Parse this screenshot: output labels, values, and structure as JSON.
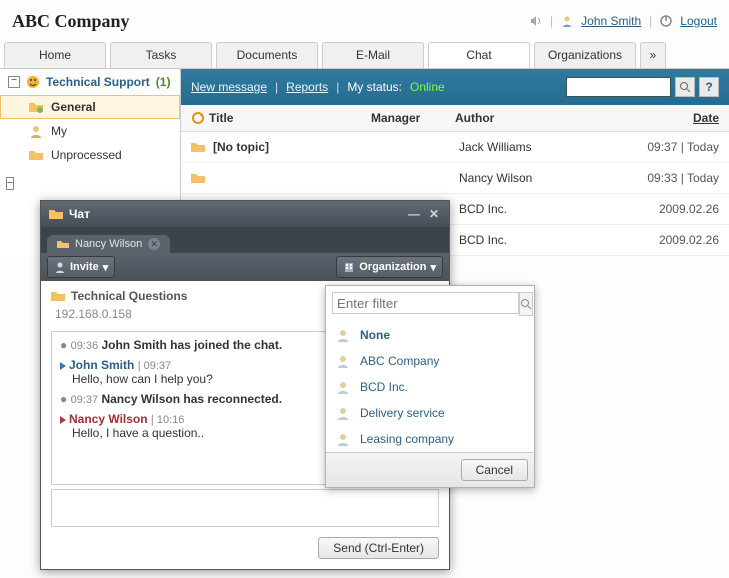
{
  "header": {
    "company": "ABC Company",
    "user": "John Smith",
    "logout": "Logout"
  },
  "tabs": [
    "Home",
    "Tasks",
    "Documents",
    "E-Mail",
    "Chat",
    "Organizations"
  ],
  "active_tab": "Chat",
  "sidebar": {
    "group_title": "Technical Support",
    "group_count": "(1)",
    "items": [
      {
        "label": "General",
        "selected": true
      },
      {
        "label": "My",
        "selected": false
      },
      {
        "label": "Unprocessed",
        "selected": false
      }
    ]
  },
  "chat_list": {
    "nav": {
      "new_message": "New message",
      "reports": "Reports",
      "my_status_label": "My status:",
      "my_status_value": "Online",
      "help": "?"
    },
    "columns": {
      "title": "Title",
      "manager": "Manager",
      "author": "Author",
      "date": "Date"
    },
    "rows": [
      {
        "title": "[No topic]",
        "author": "Jack Williams",
        "date": "09:37 | Today"
      },
      {
        "title": "",
        "author": "Nancy Wilson",
        "date": "09:33 | Today"
      },
      {
        "title": "",
        "author": "BCD Inc.",
        "date": "2009.02.26"
      },
      {
        "title": "",
        "author": "BCD Inc.",
        "date": "2009.02.26"
      }
    ]
  },
  "chat_dialog": {
    "title": "Чат",
    "tab_label": "Nancy Wilson",
    "invite": "Invite",
    "organization": "Organization",
    "topic": "Technical Questions",
    "participant": "Nancy Wilson",
    "participant_cut": "Nancy Wil",
    "ip": "192.168.0.158",
    "messages": [
      {
        "kind": "sys",
        "ts": "09:36",
        "text": "John Smith has joined the chat."
      },
      {
        "kind": "user",
        "user": "John Smith",
        "cls": "j",
        "ts": "09:37",
        "text": "Hello, how can I help you?"
      },
      {
        "kind": "sys",
        "ts": "09:37",
        "text": "Nancy Wilson has reconnected."
      },
      {
        "kind": "user",
        "user": "Nancy Wilson",
        "cls": "n",
        "ts": "10:16",
        "text": "Hello, I have a question.."
      }
    ],
    "send": "Send (Ctrl-Enter)"
  },
  "org_dropdown": {
    "filter_placeholder": "Enter filter",
    "items": [
      "None",
      "ABC Company",
      "BCD Inc.",
      "Delivery service",
      "Leasing company"
    ],
    "cancel": "Cancel"
  }
}
